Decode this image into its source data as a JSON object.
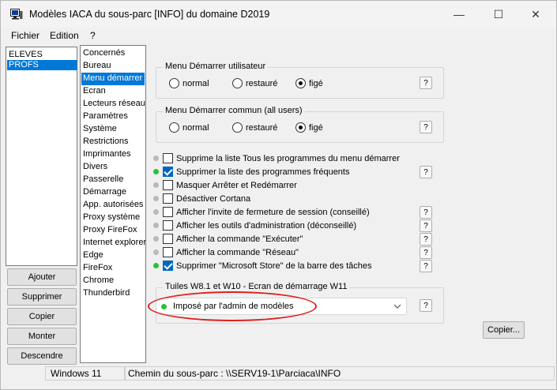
{
  "window": {
    "title": "Modèles IACA du sous-parc [INFO] du domaine D2019",
    "minimize": "—",
    "maximize": "☐",
    "close": "✕"
  },
  "menu": [
    "Fichier",
    "Edition",
    "?"
  ],
  "groups": [
    {
      "label": "ELEVES",
      "selected": false
    },
    {
      "label": "PROFS",
      "selected": true
    }
  ],
  "categories": [
    {
      "label": "Concernés",
      "selected": false
    },
    {
      "label": "Bureau",
      "selected": false
    },
    {
      "label": "Menu démarrer",
      "selected": true
    },
    {
      "label": "Ecran",
      "selected": false
    },
    {
      "label": "Lecteurs réseau",
      "selected": false
    },
    {
      "label": "Paramètres",
      "selected": false
    },
    {
      "label": "Système",
      "selected": false
    },
    {
      "label": "Restrictions",
      "selected": false
    },
    {
      "label": "Imprimantes",
      "selected": false
    },
    {
      "label": "Divers",
      "selected": false
    },
    {
      "label": "Passerelle",
      "selected": false
    },
    {
      "label": "Démarrage",
      "selected": false
    },
    {
      "label": "App. autorisées",
      "selected": false
    },
    {
      "label": "Proxy système",
      "selected": false
    },
    {
      "label": "Proxy FireFox",
      "selected": false
    },
    {
      "label": "Internet explorer",
      "selected": false
    },
    {
      "label": "Edge",
      "selected": false
    },
    {
      "label": "FireFox",
      "selected": false
    },
    {
      "label": "Chrome",
      "selected": false
    },
    {
      "label": "Thunderbird",
      "selected": false
    }
  ],
  "buttons": {
    "add": "Ajouter",
    "remove": "Supprimer",
    "copy": "Copier",
    "up": "Monter",
    "down": "Descendre",
    "copy_to": "Copier..."
  },
  "user_start": {
    "title": "Menu Démarrer utilisateur",
    "options": [
      "normal",
      "restauré",
      "figé"
    ],
    "selected": "figé",
    "help": "?"
  },
  "common_start": {
    "title": "Menu Démarrer commun (all users)",
    "options": [
      "normal",
      "restauré",
      "figé"
    ],
    "selected": "figé",
    "help": "?"
  },
  "options": [
    {
      "label": "Supprime la liste Tous les programmes du menu démarrer",
      "checked": false,
      "status": "grey",
      "help": ""
    },
    {
      "label": "Supprimer la liste des programmes fréquents",
      "checked": true,
      "status": "green",
      "help": "?"
    },
    {
      "label": "Masquer Arrêter et Redémarrer",
      "checked": false,
      "status": "grey",
      "help": ""
    },
    {
      "label": "Désactiver Cortana",
      "checked": false,
      "status": "grey",
      "help": ""
    },
    {
      "label": "Afficher l'invite de fermeture de session (conseillé)",
      "checked": false,
      "status": "grey",
      "help": "?"
    },
    {
      "label": "Afficher les outils d'administration (déconseillé)",
      "checked": false,
      "status": "grey",
      "help": "?"
    },
    {
      "label": "Afficher la commande \"Exécuter\"",
      "checked": false,
      "status": "grey",
      "help": "?"
    },
    {
      "label": "Afficher la commande \"Réseau\"",
      "checked": false,
      "status": "grey",
      "help": "?"
    },
    {
      "label": "Supprimer \"Microsoft Store\" de la barre des tâches",
      "checked": true,
      "status": "green",
      "help": "?"
    }
  ],
  "tiles": {
    "title": "Tuiles W8.1 et  W10 - Ecran de démarrage W11",
    "value": "Imposé par l'admin de modèles",
    "help": "?"
  },
  "status": {
    "os": "Windows 11",
    "path": "Chemin du sous-parc : \\\\SERV19-1\\Parciaca\\INFO"
  },
  "colors": {
    "selection": "#0078d7",
    "active_dot": "#23c437",
    "inactive_dot": "#b9b9b9",
    "highlight": "#e0201e"
  }
}
